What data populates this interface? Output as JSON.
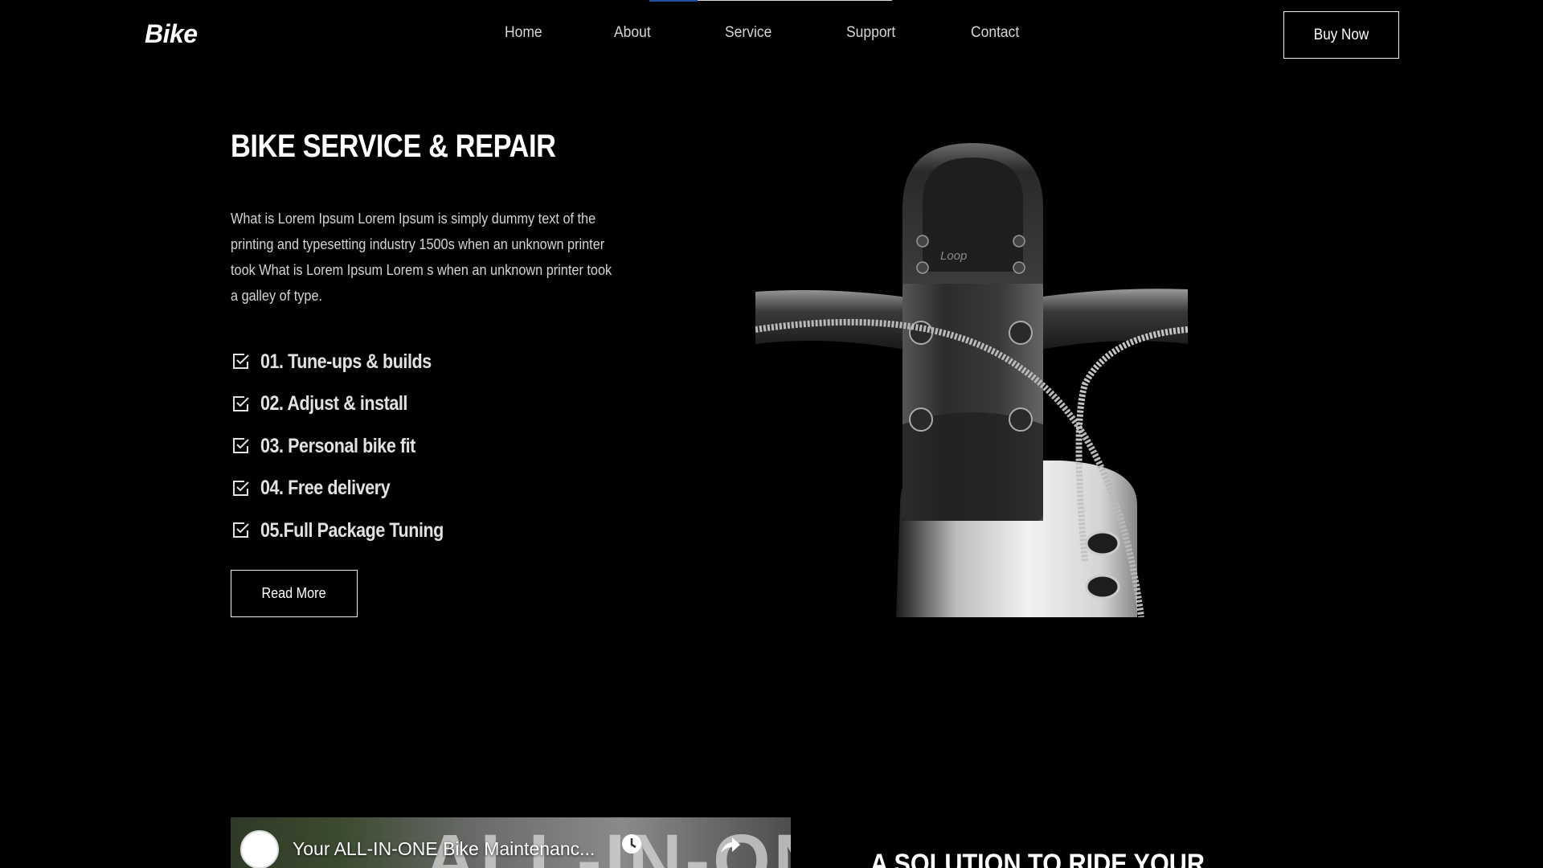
{
  "header": {
    "logo": "Bike",
    "nav": [
      "Home",
      "About",
      "Service",
      "Support",
      "Contact"
    ],
    "buy_label": "Buy Now"
  },
  "hero": {
    "title": "BIKE SERVICE & REPAIR",
    "description": "What is Lorem Ipsum Lorem Ipsum is simply dummy text of the printing and typesetting industry 1500s when an unknown printer took What is Lorem Ipsum Lorem s when an unknown printer took a galley of type.",
    "features": [
      "01. Tune-ups & builds",
      "02. Adjust & install",
      "03. Personal bike fit",
      "04. Free delivery",
      "05.Full Package Tuning"
    ],
    "read_more_label": "Read More",
    "product_brand": "Loop"
  },
  "video": {
    "title": "Your ALL-IN-ONE Bike Maintenanc...",
    "background_text": "ALL-IN-ONE"
  },
  "solution": {
    "title": "A SOLUTION TO RIDE YOUR"
  },
  "colors": {
    "background": "#000000",
    "text": "#ffffff",
    "nav_active": "#1f4fa0"
  }
}
